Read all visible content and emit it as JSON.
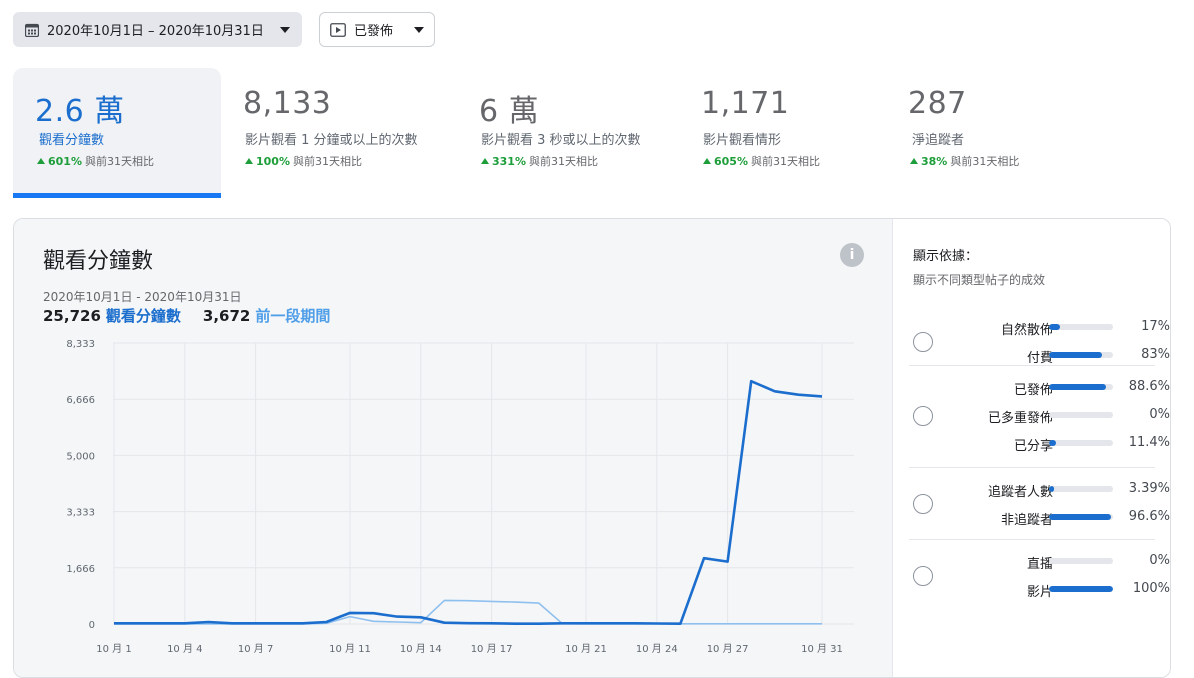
{
  "filters": {
    "date_range": "2020年10月1日 – 2020年10月31日",
    "status": "已發佈"
  },
  "metrics": [
    {
      "value": "2.6 萬",
      "label": "觀看分鐘數",
      "change": "601%",
      "compare": "與前31天相比"
    },
    {
      "value": "8,133",
      "label": "影片觀看 1 分鐘或以上的次數",
      "change": "100%",
      "compare": "與前31天相比"
    },
    {
      "value": "6 萬",
      "label": "影片觀看 3 秒或以上的次數",
      "change": "331%",
      "compare": "與前31天相比"
    },
    {
      "value": "1,171",
      "label": "影片觀看情形",
      "change": "605%",
      "compare": "與前31天相比"
    },
    {
      "value": "287",
      "label": "淨追蹤者",
      "change": "38%",
      "compare": "與前31天相比"
    }
  ],
  "chart": {
    "title": "觀看分鐘數",
    "range": "2020年10月1日 - 2020年10月31日",
    "current_value": "25,726",
    "current_label": "觀看分鐘數",
    "previous_value": "3,672",
    "previous_label": "前一段期間"
  },
  "breakdown": {
    "title": "顯示依據：",
    "subtitle": "顯示不同類型帖子的成效",
    "groups": [
      {
        "rows": [
          {
            "label": "自然散佈",
            "value": "17%",
            "fraction": 0.17
          },
          {
            "label": "付費",
            "value": "83%",
            "fraction": 0.83
          }
        ]
      },
      {
        "rows": [
          {
            "label": "已發佈",
            "value": "88.6%",
            "fraction": 0.886
          },
          {
            "label": "已多重發佈",
            "value": "0%",
            "fraction": 0
          },
          {
            "label": "已分享",
            "value": "11.4%",
            "fraction": 0.114
          }
        ]
      },
      {
        "rows": [
          {
            "label": "追蹤者人數",
            "value": "3.39%",
            "fraction": 0.0339
          },
          {
            "label": "非追蹤者",
            "value": "96.6%",
            "fraction": 0.966
          }
        ]
      },
      {
        "rows": [
          {
            "label": "直播",
            "value": "0%",
            "fraction": 0
          },
          {
            "label": "影片",
            "value": "100%",
            "fraction": 1.0
          }
        ]
      }
    ]
  },
  "colors": {
    "current": "#1b6ecd",
    "previous": "#8ec0ef",
    "positive": "#1e9e3a"
  },
  "chart_data": {
    "type": "line",
    "x": [
      1,
      2,
      3,
      4,
      5,
      6,
      7,
      8,
      9,
      10,
      11,
      12,
      13,
      14,
      15,
      16,
      17,
      18,
      19,
      20,
      21,
      22,
      23,
      24,
      25,
      26,
      27,
      28,
      29,
      30,
      31
    ],
    "xticks": [
      "10 月 1",
      "10 月 4",
      "10 月 7",
      "10 月 11",
      "10 月 14",
      "10 月 17",
      "10 月 21",
      "10 月 24",
      "10 月 27",
      "10 月 31"
    ],
    "ytick_labels": [
      "8,333",
      "6,666",
      "5,000",
      "3,333",
      "1,666",
      "0"
    ],
    "ylim": [
      0,
      8333
    ],
    "grid": true,
    "series": [
      {
        "name": "觀看分鐘數",
        "values": [
          20,
          20,
          20,
          20,
          60,
          20,
          20,
          20,
          20,
          60,
          330,
          320,
          220,
          200,
          40,
          25,
          20,
          10,
          10,
          20,
          20,
          20,
          20,
          15,
          10,
          1950,
          1850,
          7200,
          6900,
          6800,
          6750
        ]
      },
      {
        "name": "前一段期間",
        "values": [
          0,
          0,
          0,
          0,
          0,
          0,
          0,
          0,
          0,
          20,
          220,
          80,
          60,
          40,
          700,
          690,
          670,
          650,
          620,
          10,
          5,
          5,
          5,
          5,
          5,
          5,
          5,
          5,
          5,
          5,
          5
        ]
      }
    ]
  }
}
